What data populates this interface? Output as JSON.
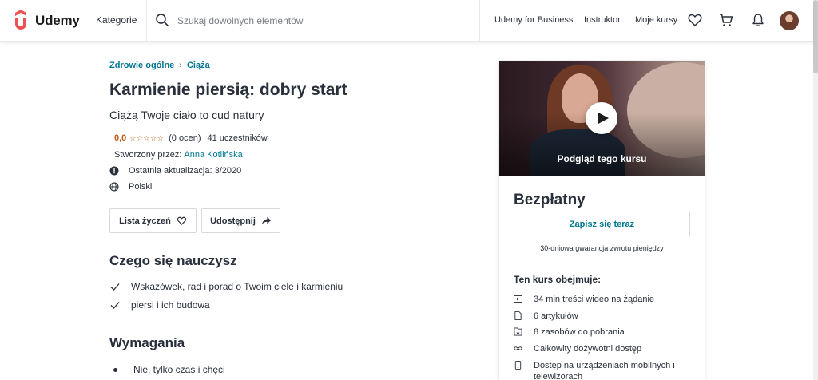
{
  "header": {
    "logo_text": "Udemy",
    "categories": "Kategorie",
    "search_placeholder": "Szukaj dowolnych elementów",
    "nav": [
      "Udemy for Business",
      "Instruktor",
      "Moje kursy"
    ]
  },
  "colors": {
    "brand": "#ec5252",
    "link": "#007791",
    "rating": "#be5a0e",
    "text": "#29303b"
  },
  "breadcrumb": [
    "Zdrowie ogólne",
    "Ciąża"
  ],
  "course": {
    "title": "Karmienie piersią: dobry start",
    "subtitle": "Ciążą Twoje ciało to cud natury",
    "rating_value": "0,0",
    "stars": "☆☆☆☆☆",
    "rating_count": "(0 ocen)",
    "students": "41 uczestników",
    "created_by_label": "Stworzony przez:",
    "author": "Anna Kotlińska",
    "last_update": "Ostatnia aktualizacja: 3/2020",
    "language": "Polski"
  },
  "actions": {
    "wishlist": "Lista życzeń",
    "share": "Udostępnij"
  },
  "learn": {
    "title": "Czego się nauczysz",
    "items": [
      "Wskazówek, rad i porad o Twoim ciele i karmieniu",
      "piersi i ich budowa"
    ]
  },
  "requirements": {
    "title": "Wymagania",
    "items": [
      "Nie, tylko czas i chęci"
    ]
  },
  "sidebar": {
    "preview_label": "Podgląd tego kursu",
    "price": "Bezpłatny",
    "enroll": "Zapisz się teraz",
    "guarantee": "30-dniowa gwarancja zwrotu pieniędzy",
    "includes_title": "Ten kurs obejmuje:",
    "includes": [
      {
        "icon": "video-icon",
        "text": "34 min treści wideo na żądanie"
      },
      {
        "icon": "article-icon",
        "text": "6 artykułów"
      },
      {
        "icon": "download-icon",
        "text": "8 zasobów do pobrania"
      },
      {
        "icon": "infinity-icon",
        "text": "Całkowity dożywotni dostęp"
      },
      {
        "icon": "mobile-icon",
        "text": "Dostęp na urządzeniach mobilnych i telewizorach"
      }
    ]
  }
}
